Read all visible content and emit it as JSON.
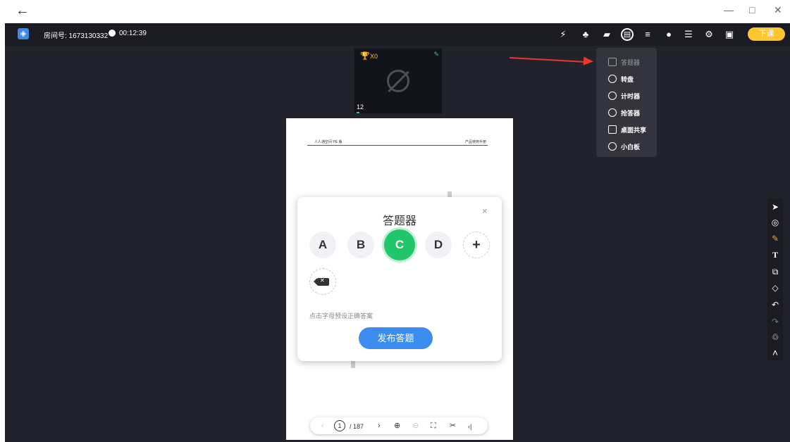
{
  "window": {
    "back": "←",
    "minimize": "—",
    "maximize": "□",
    "close": "✕"
  },
  "header": {
    "room_label": "房间号: 1673130332",
    "elapsed": "00:12:39",
    "end_class_label": "下课"
  },
  "toolbar_icons": [
    {
      "name": "whiteboard-icon",
      "glyph": "⚡"
    },
    {
      "name": "members-icon",
      "glyph": "♣"
    },
    {
      "name": "folder-icon",
      "glyph": "▰"
    },
    {
      "name": "toolbox-icon",
      "glyph": "▤"
    },
    {
      "name": "settings-mixer-icon",
      "glyph": "≡"
    },
    {
      "name": "chat-icon",
      "glyph": "●"
    },
    {
      "name": "layout-icon",
      "glyph": "☰"
    },
    {
      "name": "gear-icon",
      "glyph": "⚙"
    },
    {
      "name": "fullscreen-icon",
      "glyph": "▣"
    }
  ],
  "tool_menu": {
    "items": [
      {
        "label": "答题器",
        "icon": "answer-sheet-icon",
        "disabled": true
      },
      {
        "label": "转盘",
        "icon": "spinner-icon",
        "disabled": false
      },
      {
        "label": "计时器",
        "icon": "stopwatch-icon",
        "disabled": false
      },
      {
        "label": "抢答器",
        "icon": "quick-answer-icon",
        "disabled": false
      },
      {
        "label": "桌面共享",
        "icon": "screen-share-icon",
        "disabled": false
      },
      {
        "label": "小白板",
        "icon": "mini-whiteboard-icon",
        "disabled": false
      }
    ]
  },
  "video": {
    "trophy": "🏆",
    "trophy_count": "X0",
    "pen": "✎",
    "user_number": "12"
  },
  "document": {
    "header_left": "人人通空间 PE 版",
    "header_right": "产品使用手册"
  },
  "pager": {
    "prev": "‹",
    "current_page": "1",
    "total_pages": "/ 187",
    "next": "›",
    "zoom_in": "⊕",
    "zoom_out": "⊖",
    "fit": "⛶",
    "cut": "✂",
    "collapse": "‹|"
  },
  "answer_dialog": {
    "title": "答题器",
    "close": "×",
    "options": [
      "A",
      "B",
      "C",
      "D"
    ],
    "selected": "C",
    "add": "+",
    "delete": "✕",
    "hint": "点击字母预设正确答案",
    "publish_label": "发布答题"
  },
  "right_tools": [
    {
      "name": "select-icon",
      "glyph": "➤"
    },
    {
      "name": "laser-pointer-icon",
      "glyph": "◎"
    },
    {
      "name": "pencil-icon",
      "glyph": "✎"
    },
    {
      "name": "text-icon",
      "glyph": "T"
    },
    {
      "name": "shape-icon",
      "glyph": "⧉"
    },
    {
      "name": "eraser-icon",
      "glyph": "◇"
    },
    {
      "name": "undo-icon",
      "glyph": "↶"
    },
    {
      "name": "redo-icon",
      "glyph": "↷"
    },
    {
      "name": "trash-icon",
      "glyph": "♲"
    },
    {
      "name": "collapse-up-icon",
      "glyph": "˄"
    }
  ],
  "colors": {
    "accent_green": "#21c56a",
    "publish_blue": "#3b8ef0",
    "end_class_yellow": "#ffc531",
    "annotation_red": "#e63a2b",
    "stage_bg": "#22222d"
  }
}
